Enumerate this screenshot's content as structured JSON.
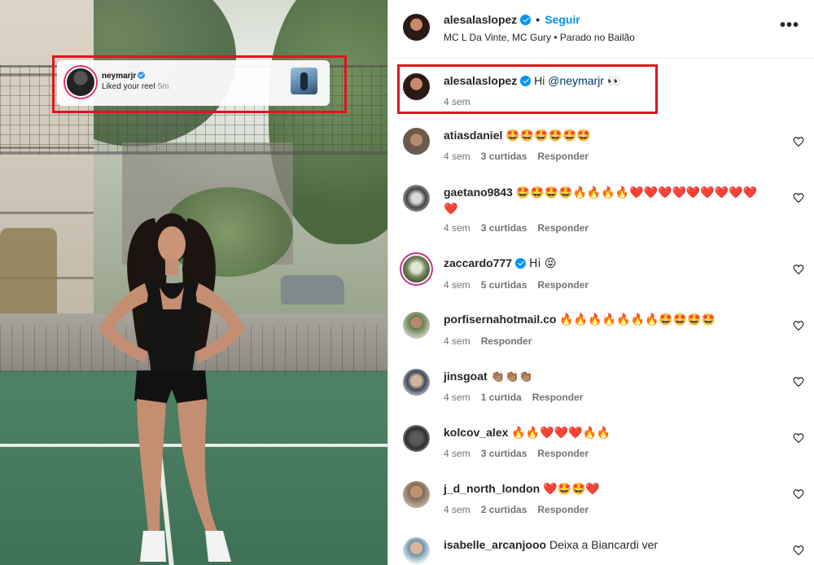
{
  "notification": {
    "username": "neymarjr",
    "message": "Liked your reel",
    "time": "5m"
  },
  "post": {
    "username": "alesalaslopez",
    "follow_label": "Seguir",
    "separator": "•",
    "music": "MC L Da Vinte, MC Gury • Parado no Bailão",
    "more_label": "•••"
  },
  "caption": {
    "username": "alesalaslopez",
    "text_before": "Hi ",
    "mention": "@neymarjr",
    "text_after": " 👀",
    "time": "4 sem"
  },
  "comments": [
    {
      "username": "atiasdaniel",
      "verified": false,
      "text": "🤩🤩🤩🤩🤩🤩",
      "time": "4 sem",
      "likes": "3 curtidas",
      "reply": "Responder"
    },
    {
      "username": "gaetano9843",
      "verified": false,
      "text": "🤩🤩🤩🤩🔥🔥🔥🔥❤️❤️❤️❤️❤️❤️❤️❤️❤️❤️",
      "time": "4 sem",
      "likes": "3 curtidas",
      "reply": "Responder"
    },
    {
      "username": "zaccardo777",
      "verified": true,
      "text": "Hi 😝",
      "time": "4 sem",
      "likes": "5 curtidas",
      "reply": "Responder"
    },
    {
      "username": "porfisernahotmail.co",
      "verified": false,
      "text": "🔥🔥🔥🔥🔥🔥🔥🤩🤩🤩🤩",
      "time": "4 sem",
      "likes": "",
      "reply": "Responder"
    },
    {
      "username": "jinsgoat",
      "verified": false,
      "text": "👏🏽👏🏽👏🏽",
      "time": "4 sem",
      "likes": "1 curtida",
      "reply": "Responder"
    },
    {
      "username": "kolcov_alex",
      "verified": false,
      "text": "🔥🔥❤️❤️❤️🔥🔥",
      "time": "4 sem",
      "likes": "3 curtidas",
      "reply": "Responder"
    },
    {
      "username": "j_d_north_london",
      "verified": false,
      "text": "❤️🤩🤩❤️",
      "time": "4 sem",
      "likes": "2 curtidas",
      "reply": "Responder"
    },
    {
      "username": "isabelle_arcanjooo",
      "verified": false,
      "text": "Deixa a Biancardi ver",
      "time": "",
      "likes": "",
      "reply": ""
    }
  ],
  "colors": {
    "highlight_box": "#e0141e",
    "link_blue": "#0095f6",
    "verified_blue": "#0095f6",
    "muted": "#737373"
  },
  "icons": {
    "heart": "heart-outline-icon",
    "verified": "verified-badge-icon",
    "more": "more-options-icon"
  }
}
